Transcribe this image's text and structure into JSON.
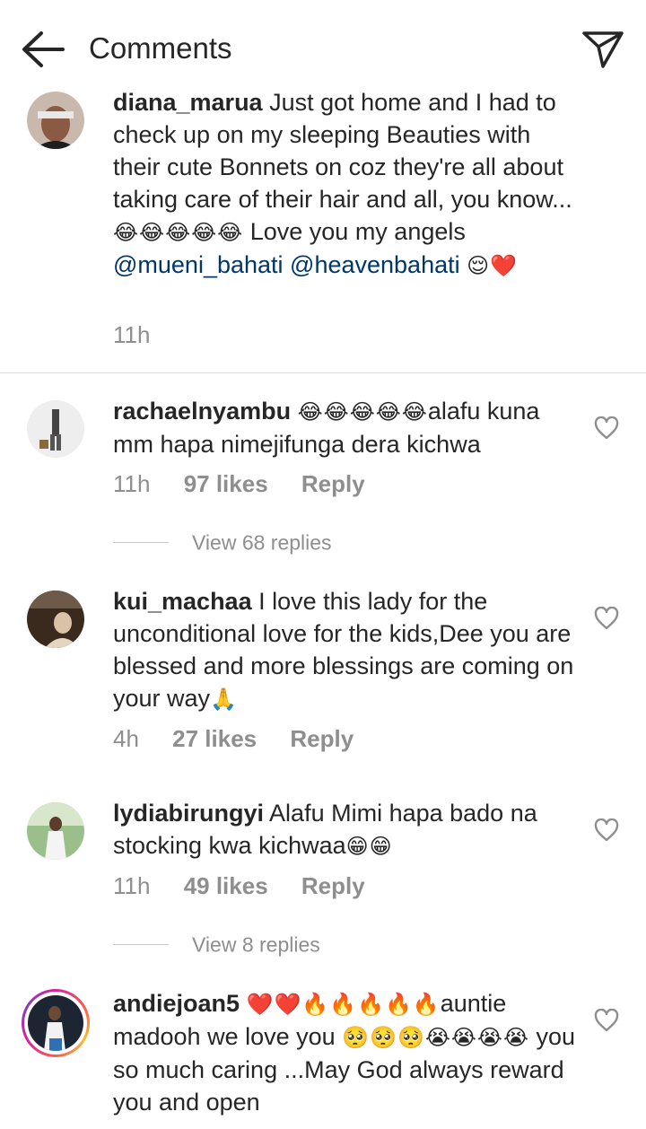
{
  "header": {
    "title": "Comments",
    "back_icon": "arrow-left-icon",
    "send_icon": "paper-plane-icon"
  },
  "caption": {
    "username": "diana_marua",
    "text_before": "Just got home and I had to check up on my sleeping Beauties with their cute Bonnets on coz they're all about taking care of their hair and all, you know...",
    "emojis_1": "😂😂😂😂😂",
    "text_middle": "Love you my angels",
    "mention_1": "@mueni_bahati",
    "mention_2": "@heavenbahati",
    "emojis_2": "😌❤️",
    "time": "11h"
  },
  "comments": [
    {
      "username": "rachaelnyambu",
      "emojis": "😂😂😂😂😂",
      "text": "alafu kuna mm hapa nimejifunga dera kichwa",
      "time": "11h",
      "likes": "97 likes",
      "reply": "Reply",
      "view_replies": "View 68 replies"
    },
    {
      "username": "kui_machaa",
      "text": "I love this lady for the unconditional love for the kids,Dee you are blessed and more blessings are coming on your way",
      "emojis": "🙏",
      "time": "4h",
      "likes": "27 likes",
      "reply": "Reply"
    },
    {
      "username": "lydiabirungyi",
      "text": "Alafu Mimi hapa bado na stocking kwa kichwaa",
      "emojis": "😁😁",
      "time": "11h",
      "likes": "49 likes",
      "reply": "Reply",
      "view_replies": "View 8 replies"
    },
    {
      "username": "andiejoan5",
      "emojis_1": "❤️❤️🔥🔥🔥🔥🔥",
      "text_1": "auntie madooh we love you",
      "emojis_2": "🥺🥺🥺😭😭😭😭",
      "text_2": "you so much caring ...May God always reward you and open"
    }
  ],
  "colors": {
    "text": "#262626",
    "secondary": "#8e8e8e",
    "mention": "#00376b",
    "divider": "#dbdbdb"
  }
}
